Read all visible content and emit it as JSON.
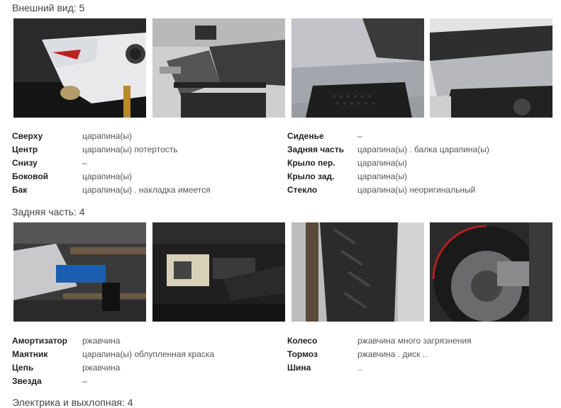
{
  "sections": [
    {
      "title": "Внешний вид: 5",
      "photos": [
        {
          "name": "photo-front-fairing"
        },
        {
          "name": "photo-side-luggage-rack"
        },
        {
          "name": "photo-fuel-tank-side"
        },
        {
          "name": "photo-seat-side-panel"
        }
      ],
      "left_specs": [
        {
          "key": "Сверху",
          "value": "царапина(ы)"
        },
        {
          "key": "Центр",
          "value": "царапина(ы) потертость"
        },
        {
          "key": "Снизу",
          "value": "–"
        },
        {
          "key": "Боковой",
          "value": "царапина(ы)"
        },
        {
          "key": "Бак",
          "value": "царапина(ы) . накладка имеется"
        }
      ],
      "right_specs": [
        {
          "key": "Сиденье",
          "value": "–"
        },
        {
          "key": "Задняя часть",
          "value": "царапина(ы) . балка царапина(ы)"
        },
        {
          "key": "Крыло пер.",
          "value": "царапина(ы)"
        },
        {
          "key": "Крыло зад.",
          "value": "царапина(ы)"
        },
        {
          "key": "Стекло",
          "value": "царапина(ы) неоригинальный"
        }
      ]
    },
    {
      "title": "Задняя часть: 4",
      "photos": [
        {
          "name": "photo-swingarm-chain"
        },
        {
          "name": "photo-rear-shock"
        },
        {
          "name": "photo-rear-tire"
        },
        {
          "name": "photo-rear-brake-disc"
        }
      ],
      "left_specs": [
        {
          "key": "Амортизатор",
          "value": "ржавчина"
        },
        {
          "key": "Маятник",
          "value": "царапина(ы) облупленная краска"
        },
        {
          "key": "Цепь",
          "value": "ржавчина"
        },
        {
          "key": "Звезда",
          "value": "–"
        }
      ],
      "right_specs": [
        {
          "key": "Колесо",
          "value": "ржавчина много загрязнения"
        },
        {
          "key": "Тормоз",
          "value": "ржавчина . диск .."
        },
        {
          "key": "Шина",
          "value": ".."
        }
      ]
    },
    {
      "title": "Электрика и выхлопная: 4"
    }
  ],
  "colors": {
    "label": "#222222",
    "value": "#555555",
    "heading": "#444444"
  }
}
